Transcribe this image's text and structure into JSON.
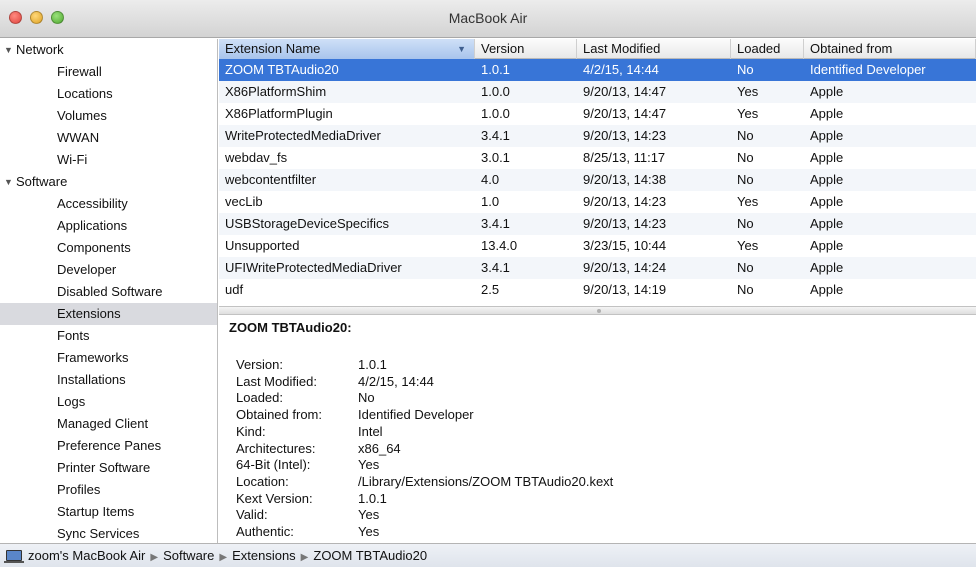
{
  "window": {
    "title": "MacBook Air"
  },
  "sidebar": {
    "groups": [
      {
        "label": "Network",
        "items": [
          "Firewall",
          "Locations",
          "Volumes",
          "WWAN",
          "Wi-Fi"
        ]
      },
      {
        "label": "Software",
        "items": [
          "Accessibility",
          "Applications",
          "Components",
          "Developer",
          "Disabled Software",
          "Extensions",
          "Fonts",
          "Frameworks",
          "Installations",
          "Logs",
          "Managed Client",
          "Preference Panes",
          "Printer Software",
          "Profiles",
          "Startup Items",
          "Sync Services"
        ]
      }
    ],
    "selected": "Extensions"
  },
  "table": {
    "columns": [
      "Extension Name",
      "Version",
      "Last Modified",
      "Loaded",
      "Obtained from"
    ],
    "sorted_column": "Extension Name",
    "rows": [
      [
        "ZOOM TBTAudio20",
        "1.0.1",
        "4/2/15, 14:44",
        "No",
        "Identified Developer"
      ],
      [
        "X86PlatformShim",
        "1.0.0",
        "9/20/13, 14:47",
        "Yes",
        "Apple"
      ],
      [
        "X86PlatformPlugin",
        "1.0.0",
        "9/20/13, 14:47",
        "Yes",
        "Apple"
      ],
      [
        "WriteProtectedMediaDriver",
        "3.4.1",
        "9/20/13, 14:23",
        "No",
        "Apple"
      ],
      [
        "webdav_fs",
        "3.0.1",
        "8/25/13, 11:17",
        "No",
        "Apple"
      ],
      [
        "webcontentfilter",
        "4.0",
        "9/20/13, 14:38",
        "No",
        "Apple"
      ],
      [
        "vecLib",
        "1.0",
        "9/20/13, 14:23",
        "Yes",
        "Apple"
      ],
      [
        "USBStorageDeviceSpecifics",
        "3.4.1",
        "9/20/13, 14:23",
        "No",
        "Apple"
      ],
      [
        "Unsupported",
        "13.4.0",
        "3/23/15, 10:44",
        "Yes",
        "Apple"
      ],
      [
        "UFIWriteProtectedMediaDriver",
        "3.4.1",
        "9/20/13, 14:24",
        "No",
        "Apple"
      ],
      [
        "udf",
        "2.5",
        "9/20/13, 14:19",
        "No",
        "Apple"
      ]
    ],
    "selected_row": 0
  },
  "detail": {
    "title": "ZOOM TBTAudio20:",
    "fields": [
      {
        "key": "Version:",
        "value": "1.0.1"
      },
      {
        "key": "Last Modified:",
        "value": "4/2/15, 14:44"
      },
      {
        "key": "Loaded:",
        "value": "No"
      },
      {
        "key": "Obtained from:",
        "value": "Identified Developer"
      },
      {
        "key": "Kind:",
        "value": "Intel"
      },
      {
        "key": "Architectures:",
        "value": "x86_64"
      },
      {
        "key": "64-Bit (Intel):",
        "value": "Yes"
      },
      {
        "key": "Location:",
        "value": "/Library/Extensions/ZOOM TBTAudio20.kext"
      },
      {
        "key": "Kext Version:",
        "value": "1.0.1"
      },
      {
        "key": "Valid:",
        "value": "Yes"
      },
      {
        "key": "Authentic:",
        "value": "Yes"
      }
    ]
  },
  "breadcrumb": {
    "icon": "laptop-icon",
    "items": [
      "zoom's MacBook Air",
      "Software",
      "Extensions",
      "ZOOM TBTAudio20"
    ]
  },
  "colors": {
    "selection": "#3875d7",
    "sidebar_selection": "#d9dadf",
    "sorted_header": "#a8c4ec"
  }
}
